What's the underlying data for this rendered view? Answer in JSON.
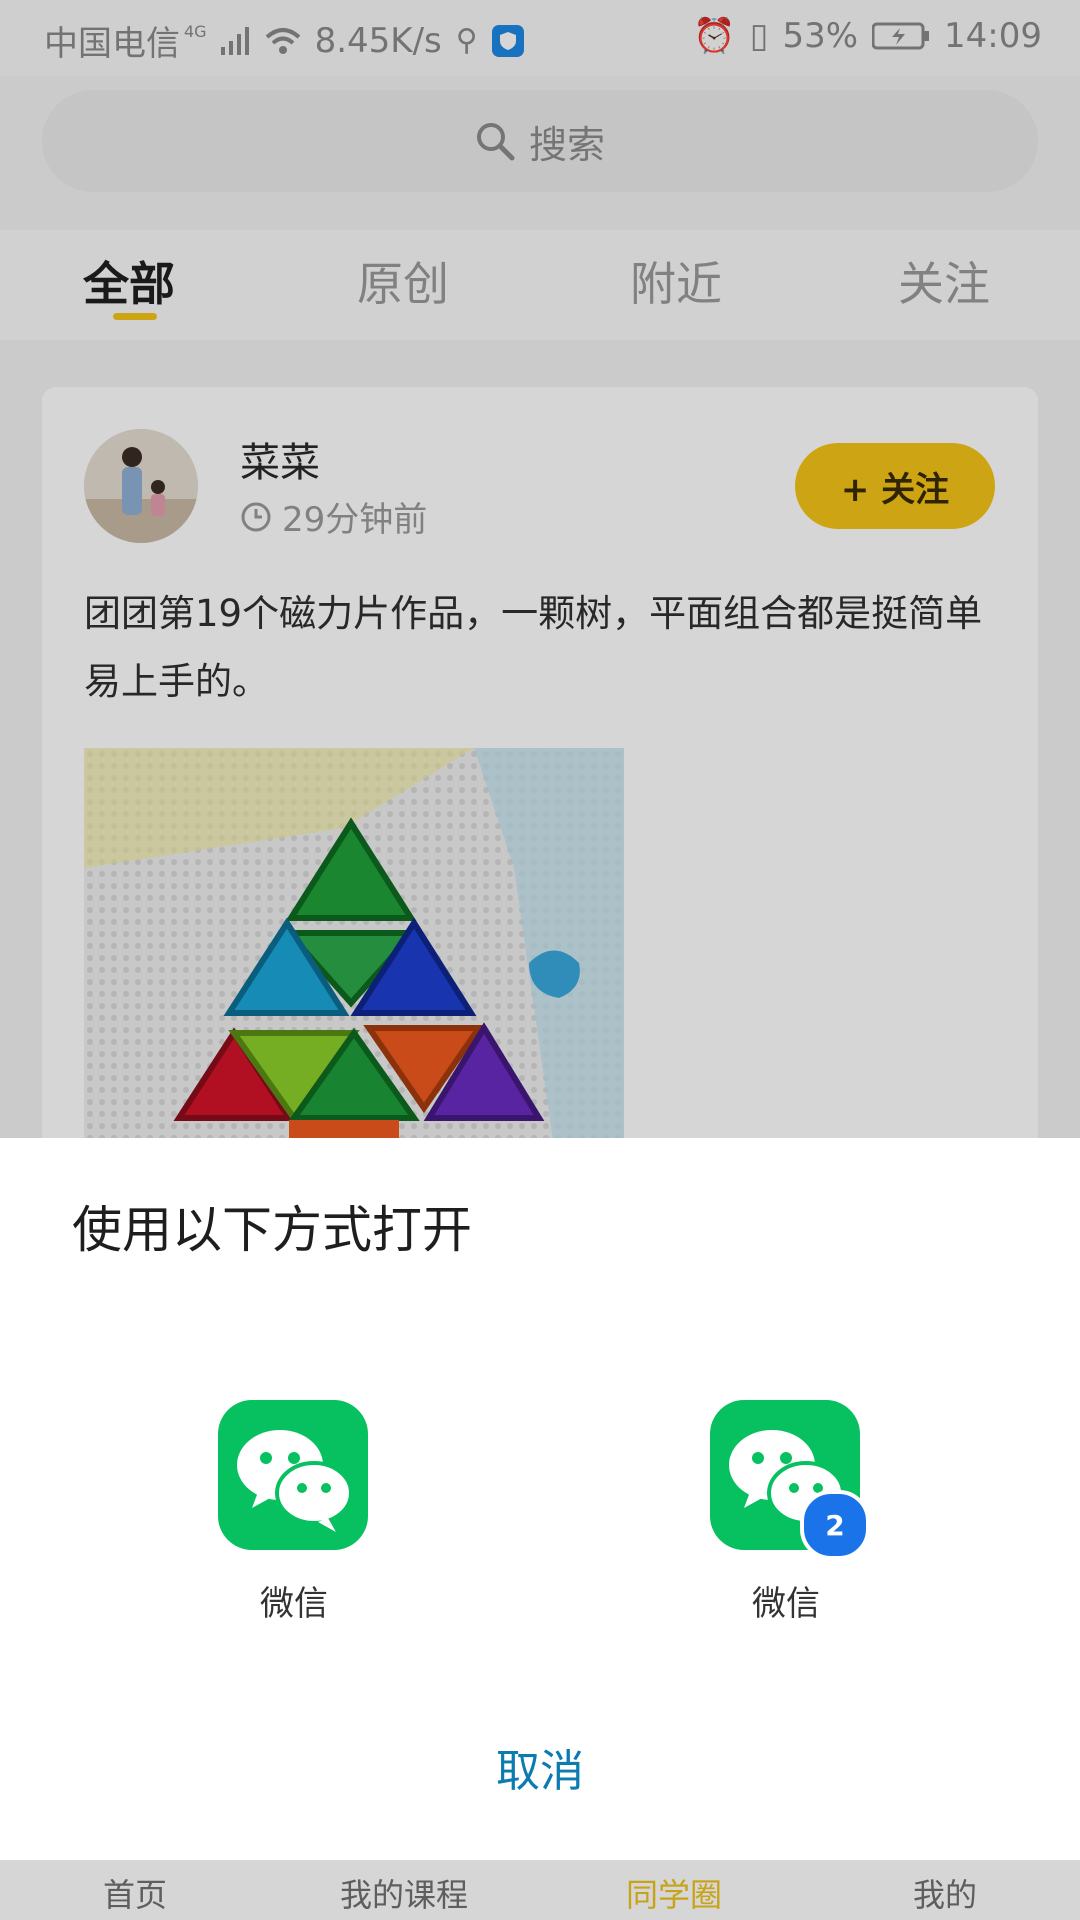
{
  "status_bar": {
    "carrier": "中国电信",
    "network": "4G",
    "speed": "8.45K/s",
    "battery": "53%",
    "time": "14:09"
  },
  "search": {
    "placeholder": "搜索"
  },
  "tabs": [
    {
      "label": "全部",
      "active": true
    },
    {
      "label": "原创",
      "active": false
    },
    {
      "label": "附近",
      "active": false
    },
    {
      "label": "关注",
      "active": false
    }
  ],
  "post": {
    "username": "菜菜",
    "time": "29分钟前",
    "follow_label": "+ 关注",
    "text": "团团第19个磁力片作品，一颗树，平面组合都是挺简单易上手的。"
  },
  "sheet": {
    "title": "使用以下方式打开",
    "apps": [
      {
        "label": "微信",
        "icon": "wechat-icon"
      },
      {
        "label": "微信",
        "icon": "wechat-clone-icon",
        "badge": "2"
      }
    ],
    "cancel_label": "取消"
  },
  "bottom_nav": [
    {
      "label": "首页",
      "active": false
    },
    {
      "label": "我的课程",
      "active": false
    },
    {
      "label": "同学圈",
      "active": true
    },
    {
      "label": "我的",
      "active": false
    }
  ],
  "colors": {
    "accent_yellow": "#f5c518",
    "wechat_green": "#07c160",
    "cancel_blue": "#0b7bb0",
    "badge_blue": "#1a73e8"
  }
}
